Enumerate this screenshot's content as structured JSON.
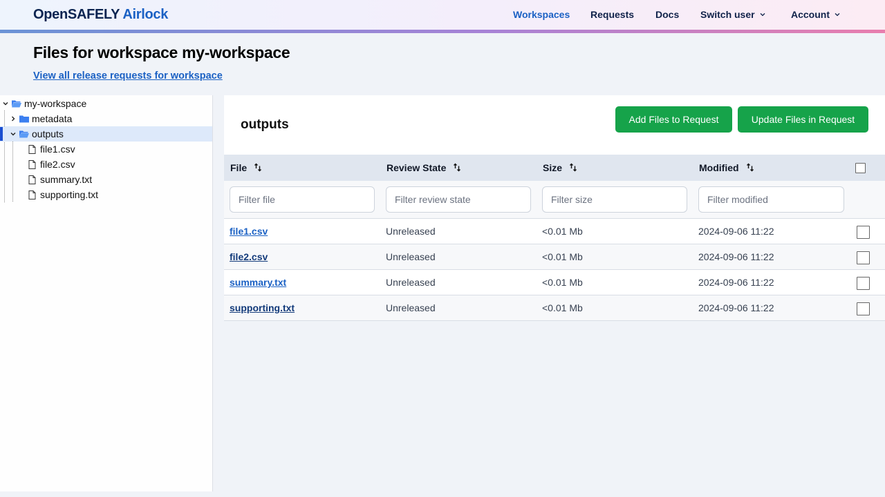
{
  "header": {
    "brand_main": "OpenSAFELY",
    "brand_accent": "Airlock",
    "nav": [
      {
        "label": "Workspaces",
        "active": true
      },
      {
        "label": "Requests",
        "active": false
      },
      {
        "label": "Docs",
        "active": false
      },
      {
        "label": "Switch user",
        "dropdown": true
      },
      {
        "label": "Account",
        "dropdown": true
      }
    ]
  },
  "page": {
    "title": "Files for workspace my-workspace",
    "link": "View all release requests for workspace"
  },
  "tree": {
    "root": {
      "label": "my-workspace",
      "expanded": true
    },
    "items": [
      {
        "label": "metadata",
        "type": "folder",
        "expanded": false
      },
      {
        "label": "outputs",
        "type": "folder",
        "expanded": true,
        "selected": true
      },
      {
        "label": "file1.csv",
        "type": "file"
      },
      {
        "label": "file2.csv",
        "type": "file"
      },
      {
        "label": "summary.txt",
        "type": "file"
      },
      {
        "label": "supporting.txt",
        "type": "file"
      }
    ]
  },
  "panel": {
    "title": "outputs",
    "add_button": "Add Files to Request",
    "update_button": "Update Files in Request"
  },
  "table": {
    "columns": [
      "File",
      "Review State",
      "Size",
      "Modified"
    ],
    "filters": [
      "Filter file",
      "Filter review state",
      "Filter size",
      "Filter modified"
    ],
    "rows": [
      {
        "file": "file1.csv",
        "state": "Unreleased",
        "size": "<0.01 Mb",
        "modified": "2024-09-06 11:22"
      },
      {
        "file": "file2.csv",
        "state": "Unreleased",
        "size": "<0.01 Mb",
        "modified": "2024-09-06 11:22"
      },
      {
        "file": "summary.txt",
        "state": "Unreleased",
        "size": "<0.01 Mb",
        "modified": "2024-09-06 11:22"
      },
      {
        "file": "supporting.txt",
        "state": "Unreleased",
        "size": "<0.01 Mb",
        "modified": "2024-09-06 11:22"
      }
    ]
  },
  "colors": {
    "accent": "#1b61c4",
    "button_green": "#16a34a",
    "selected_row": "#dde9fa"
  }
}
